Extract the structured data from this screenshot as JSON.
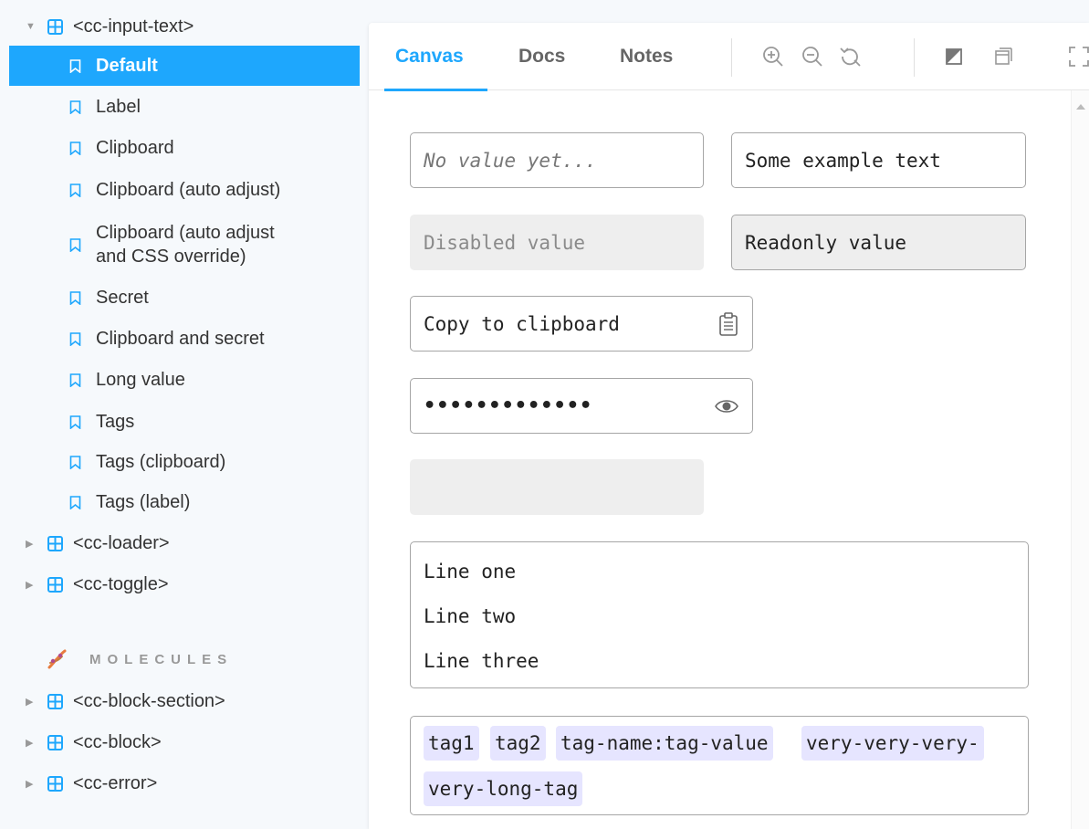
{
  "sidebar": {
    "components_top": [
      {
        "label": "<cc-input-text>",
        "expanded": true
      }
    ],
    "stories": [
      {
        "label": "Default",
        "selected": true
      },
      {
        "label": "Label"
      },
      {
        "label": "Clipboard"
      },
      {
        "label": "Clipboard (auto adjust)"
      },
      {
        "label_line1": "Clipboard (auto adjust",
        "label_line2": "and CSS override)"
      },
      {
        "label": "Secret"
      },
      {
        "label": "Clipboard and secret"
      },
      {
        "label": "Long value"
      },
      {
        "label": "Tags"
      },
      {
        "label": "Tags (clipboard)"
      },
      {
        "label": "Tags (label)"
      }
    ],
    "components_after": [
      {
        "label": "<cc-loader>"
      },
      {
        "label": "<cc-toggle>"
      }
    ],
    "section_title": "MOLECULES",
    "molecules": [
      {
        "label": "<cc-block-section>"
      },
      {
        "label": "<cc-block>"
      },
      {
        "label": "<cc-error>"
      }
    ]
  },
  "toolbar": {
    "tabs": [
      {
        "label": "Canvas",
        "active": true
      },
      {
        "label": "Docs"
      },
      {
        "label": "Notes"
      }
    ],
    "icons": [
      "zoom-in-icon",
      "zoom-out-icon",
      "zoom-reset-icon",
      "background-icon",
      "grid-icon",
      "fullscreen-icon"
    ]
  },
  "canvas": {
    "empty_input_placeholder": "No value yet...",
    "example_value": "Some example text",
    "disabled_value": "Disabled value",
    "readonly_value": "Readonly value",
    "clipboard_value": "Copy to clipboard",
    "secret_value": "•••••••••••••",
    "textarea_lines": [
      "Line one",
      "Line two",
      "Line three"
    ],
    "tags": [
      "tag1",
      "tag2",
      "tag-name:tag-value",
      "very-very-very-",
      "very-long-tag"
    ]
  },
  "colors": {
    "accent": "#1ea7fd",
    "tag_background": "#e6e5ff",
    "disabled_background": "#eeeeee",
    "icon_teal": "#1ea7fd"
  }
}
